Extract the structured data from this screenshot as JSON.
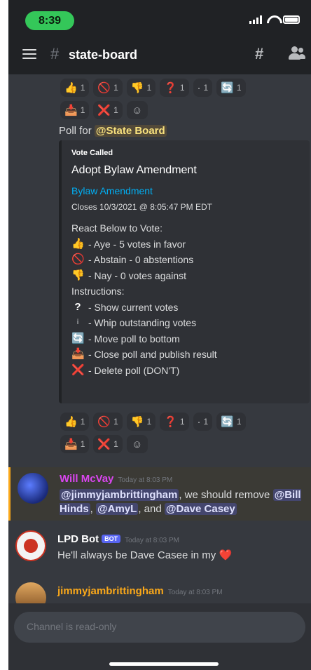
{
  "status_bar": {
    "time": "8:39"
  },
  "header": {
    "channel_hash": "#",
    "channel_name": "state-board"
  },
  "reactions_top": {
    "row1": [
      {
        "emoji": "👍",
        "count": "1"
      },
      {
        "emoji": "🚫",
        "count": "1"
      },
      {
        "emoji": "👎",
        "count": "1"
      },
      {
        "emoji": "❓",
        "count": "1"
      },
      {
        "emoji": "·",
        "count": "1"
      },
      {
        "emoji": "🔄",
        "count": "1"
      }
    ],
    "row2": [
      {
        "emoji": "📥",
        "count": "1"
      },
      {
        "emoji": "❌",
        "count": "1"
      }
    ]
  },
  "poll": {
    "intro": "Poll for",
    "mention": "@State Board",
    "embed": {
      "author": "Vote Called",
      "title": "Adopt Bylaw Amendment",
      "link": "Bylaw Amendment",
      "closes": "Closes 10/3/2021 @ 8:05:47 PM EDT",
      "lines": [
        {
          "emoji": "",
          "text": "React Below to Vote:"
        },
        {
          "emoji": "👍",
          "text": "- Aye - 5 votes in favor"
        },
        {
          "emoji": "🚫",
          "text": "- Abstain - 0 abstentions"
        },
        {
          "emoji": "👎",
          "text": "- Nay - 0 votes against"
        },
        {
          "emoji": "",
          "text": "Instructions:"
        },
        {
          "emoji": "?",
          "text": "- Show current votes"
        },
        {
          "emoji": "ⅰ",
          "text": "- Whip outstanding votes"
        },
        {
          "emoji": "🔄",
          "text": "- Move poll to bottom"
        },
        {
          "emoji": "📥",
          "text": "- Close poll and publish result"
        },
        {
          "emoji": "❌",
          "text": "- Delete poll (DON'T)"
        }
      ]
    }
  },
  "reactions_bottom": {
    "row1": [
      {
        "emoji": "👍",
        "count": "1"
      },
      {
        "emoji": "🚫",
        "count": "1"
      },
      {
        "emoji": "👎",
        "count": "1"
      },
      {
        "emoji": "❓",
        "count": "1"
      },
      {
        "emoji": "·",
        "count": "1"
      },
      {
        "emoji": "🔄",
        "count": "1"
      }
    ],
    "row2": [
      {
        "emoji": "📥",
        "count": "1"
      },
      {
        "emoji": "❌",
        "count": "1"
      }
    ]
  },
  "messages": [
    {
      "author": "Will McVay",
      "timestamp": "Today at 8:03 PM",
      "m1": "@jimmyjambrittingham",
      "t1": ", we should remove ",
      "m2": "@Bill Hinds",
      "t2": ", ",
      "m3": "@AmyL",
      "t3": ", and ",
      "m4": "@Dave Casey",
      "color": "#d946ef"
    },
    {
      "author": "LPD Bot",
      "bot_tag": "BOT",
      "timestamp": "Today at 8:03 PM",
      "text": "He'll always be Dave Casee in my ❤️"
    },
    {
      "author": "jimmyjambrittingham",
      "timestamp": "Today at 8:03 PM",
      "color": "#faa81a"
    }
  ],
  "composer": {
    "placeholder": "Channel is read-only"
  }
}
